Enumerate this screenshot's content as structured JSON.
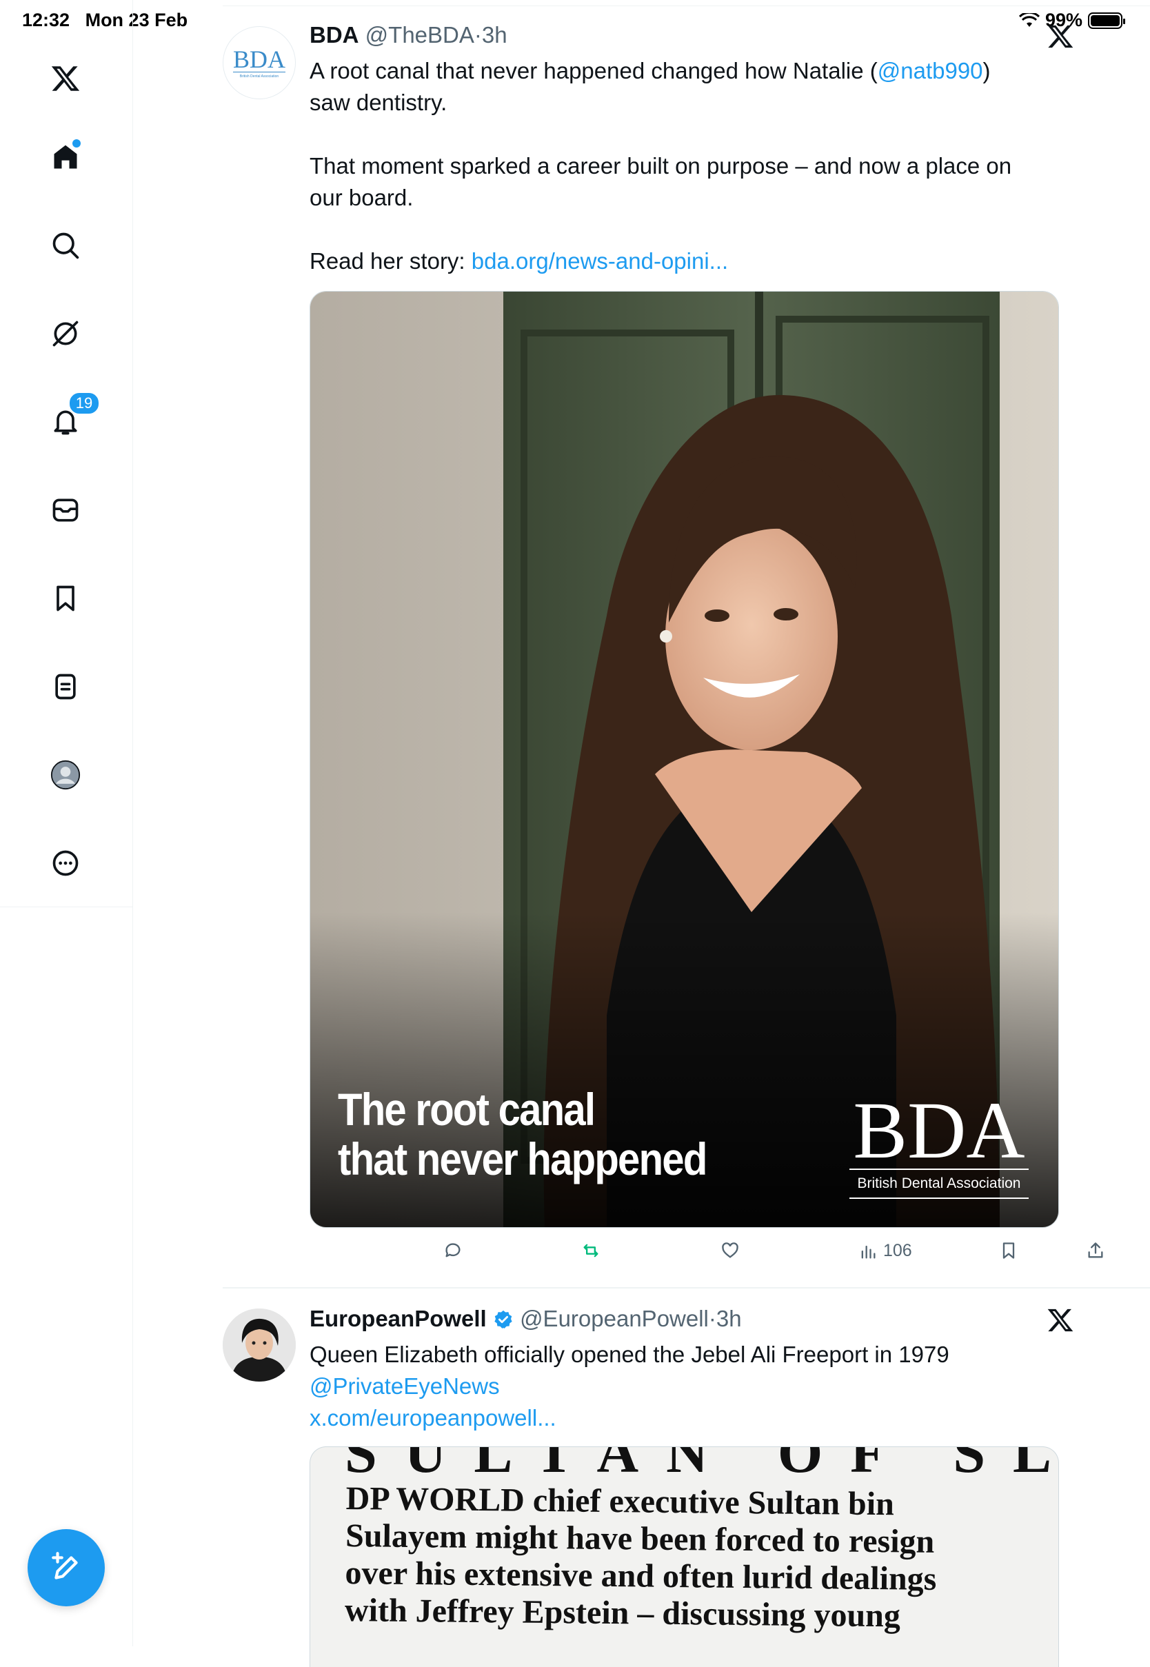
{
  "status_bar": {
    "time": "12:32",
    "date": "Mon 23 Feb",
    "battery": "99%"
  },
  "sidebar": {
    "notifications_count": "19",
    "items": [
      "x-logo",
      "home",
      "search",
      "grok",
      "notifications",
      "messages",
      "bookmarks",
      "lists",
      "profile",
      "more"
    ]
  },
  "tweets": [
    {
      "name": "BDA",
      "handle": "@TheBDA",
      "time": "3h",
      "avatar_text": "BDA",
      "avatar_sub": "British Dental Association",
      "text_1a": "A root canal that never happened changed how Natalie (",
      "mention": "@natb990",
      "text_1b": ")",
      "text_1c": "saw dentistry.",
      "text_2": "That moment sparked a career built on purpose – and now a place on our board.",
      "text_3": "Read her story: ",
      "link": "bda.org/news-and-opini...",
      "media": {
        "headline_1": "The root canal",
        "headline_2": "that never happened",
        "logo": "BDA",
        "logo_sub": "British Dental Association"
      },
      "views": "106"
    },
    {
      "name": "EuropeanPowell",
      "handle": "@EuropeanPowell",
      "time": "3h",
      "verified": true,
      "text": "Queen Elizabeth officially opened the Jebel Ali Freeport in 1979",
      "mention": "@PrivateEyeNews",
      "link": "x.com/europeanpowell...",
      "clipping": {
        "headline": "SULTAN OF SLEAZE",
        "body_line_1": "DP WORLD chief executive Sultan bin",
        "body_line_2": "Sulayem might have been forced to resign",
        "body_line_3": "over his extensive and often lurid dealings",
        "body_line_4": "with Jeffrey Epstein – discussing young"
      }
    }
  ],
  "colors": {
    "accent": "#1d9bf0",
    "text": "#0f1419",
    "secondary": "#536471",
    "retweet": "#00ba7c"
  }
}
